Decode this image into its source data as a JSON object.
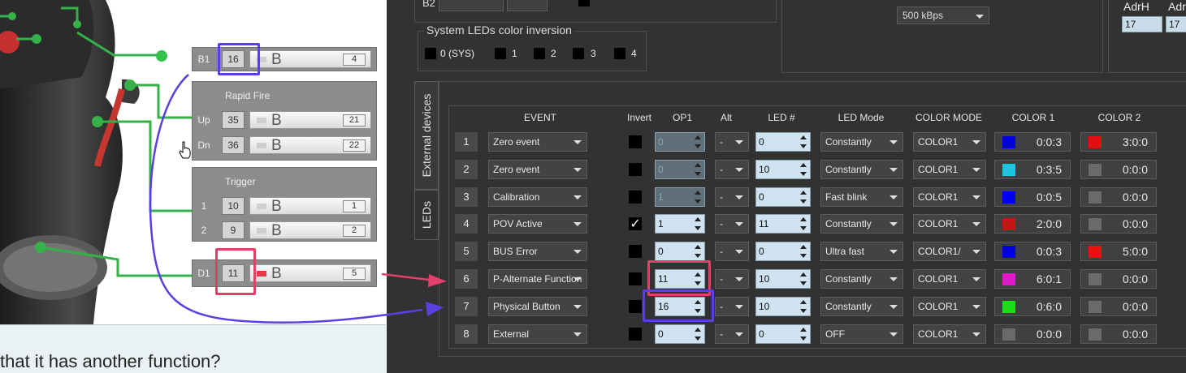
{
  "left": {
    "groups": {
      "b1": {
        "prefix": "B1",
        "num": "16",
        "b": "B",
        "val": "4"
      },
      "rapid_fire": {
        "title": "Rapid Fire",
        "rows": [
          {
            "prefix": "Up",
            "num": "35",
            "b": "B",
            "val": "21"
          },
          {
            "prefix": "Dn",
            "num": "36",
            "b": "B",
            "val": "22"
          }
        ]
      },
      "trigger": {
        "title": "Trigger",
        "rows": [
          {
            "prefix": "1",
            "num": "10",
            "b": "B",
            "val": "1"
          },
          {
            "prefix": "2",
            "num": "9",
            "b": "B",
            "val": "2"
          }
        ]
      },
      "d1": {
        "prefix": "D1",
        "num": "11",
        "b": "B",
        "val": "5"
      }
    },
    "bottom_text": "that it has another function?"
  },
  "app": {
    "top": {
      "b2_label": "B2",
      "speed_value": "500 kBps",
      "adrh_label": "AdrH",
      "adrl_label": "Adr",
      "adrh_value": "17",
      "adrl_value": "17"
    },
    "sys_leds": {
      "title": "System LEDs color inversion",
      "items": [
        "0 (SYS)",
        "1",
        "2",
        "3",
        "4"
      ]
    },
    "tabs": {
      "external": "External devices",
      "leds": "LEDs"
    },
    "headers": {
      "event": "EVENT",
      "invert": "Invert",
      "op1": "OP1",
      "alt": "Alt",
      "led": "LED #",
      "led_mode": "LED Mode",
      "color_mode": "COLOR MODE",
      "color1": "COLOR 1",
      "color2": "COLOR 2"
    },
    "rows": [
      {
        "n": "1",
        "event": "Zero event",
        "invert": false,
        "op1": "0",
        "op1_disabled": true,
        "alt": "-",
        "led": "0",
        "mode": "Constantly",
        "cmode": "COLOR1",
        "c1": "0:0:3",
        "c1hex": "#0000e0",
        "c2": "3:0:0",
        "c2hex": "#e01010"
      },
      {
        "n": "2",
        "event": "Zero event",
        "invert": false,
        "op1": "0",
        "op1_disabled": true,
        "alt": "-",
        "led": "10",
        "mode": "Constantly",
        "cmode": "COLOR1",
        "c1": "0:3:5",
        "c1hex": "#18c8e0",
        "c2": "0:0:0",
        "c2hex": "#6a6a6a"
      },
      {
        "n": "3",
        "event": "Calibration",
        "invert": false,
        "op1": "1",
        "op1_disabled": true,
        "alt": "-",
        "led": "0",
        "mode": "Fast blink",
        "cmode": "COLOR1",
        "c1": "0:0:5",
        "c1hex": "#0000ee",
        "c2": "0:0:0",
        "c2hex": "#6a6a6a"
      },
      {
        "n": "4",
        "event": "POV Active",
        "invert": true,
        "op1": "1",
        "op1_disabled": false,
        "alt": "-",
        "led": "11",
        "mode": "Constantly",
        "cmode": "COLOR1",
        "c1": "2:0:0",
        "c1hex": "#c81414",
        "c2": "0:0:0",
        "c2hex": "#6a6a6a"
      },
      {
        "n": "5",
        "event": "BUS Error",
        "invert": false,
        "op1": "0",
        "op1_disabled": false,
        "alt": "-",
        "led": "0",
        "mode": "Ultra fast",
        "cmode": "COLOR1/",
        "c1": "0:0:3",
        "c1hex": "#0000e0",
        "c2": "5:0:0",
        "c2hex": "#e81010"
      },
      {
        "n": "6",
        "event": "P-Alternate Function",
        "invert": false,
        "op1": "11",
        "op1_disabled": false,
        "alt": "-",
        "led": "10",
        "mode": "Constantly",
        "cmode": "COLOR1",
        "c1": "6:0:1",
        "c1hex": "#e018c8",
        "c2": "0:0:0",
        "c2hex": "#6a6a6a"
      },
      {
        "n": "7",
        "event": "Physical Button",
        "invert": false,
        "op1": "16",
        "op1_disabled": false,
        "alt": "-",
        "led": "10",
        "mode": "Constantly",
        "cmode": "COLOR1",
        "c1": "0:6:0",
        "c1hex": "#18e018",
        "c2": "0:0:0",
        "c2hex": "#6a6a6a"
      },
      {
        "n": "8",
        "event": "External",
        "invert": false,
        "op1": "0",
        "op1_disabled": false,
        "alt": "-",
        "led": "0",
        "mode": "OFF",
        "cmode": "COLOR1",
        "c1": "0:0:0",
        "c1hex": "#6a6a6a",
        "c2": "0:0:0",
        "c2hex": "#6a6a6a"
      }
    ]
  },
  "colors": {
    "highlight_blue": "#5b3fe0",
    "highlight_red": "#e0406a",
    "accent_green": "#34c34a"
  }
}
